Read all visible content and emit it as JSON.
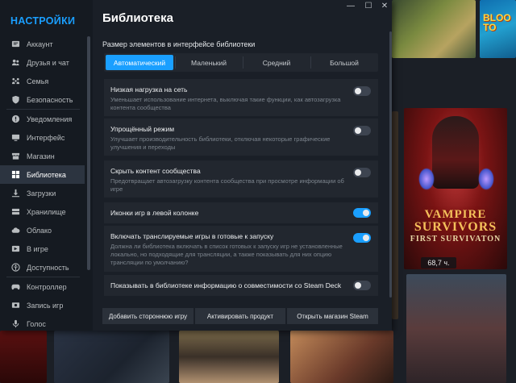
{
  "sidebar": {
    "title": "НАСТРОЙКИ",
    "items": [
      {
        "label": "Аккаунт",
        "icon": "account-icon"
      },
      {
        "label": "Друзья и чат",
        "icon": "friends-icon"
      },
      {
        "label": "Семья",
        "icon": "family-icon"
      },
      {
        "label": "Безопасность",
        "icon": "shield-icon"
      },
      {
        "label": "Уведомления",
        "icon": "notifications-icon"
      },
      {
        "label": "Интерфейс",
        "icon": "monitor-icon"
      },
      {
        "label": "Магазин",
        "icon": "store-icon"
      },
      {
        "label": "Библиотека",
        "icon": "library-grid-icon",
        "active": true
      },
      {
        "label": "Загрузки",
        "icon": "download-icon"
      },
      {
        "label": "Хранилище",
        "icon": "storage-icon"
      },
      {
        "label": "Облако",
        "icon": "cloud-icon"
      },
      {
        "label": "В игре",
        "icon": "in-game-icon"
      },
      {
        "label": "Доступность",
        "icon": "accessibility-icon"
      },
      {
        "label": "Контроллер",
        "icon": "controller-icon"
      },
      {
        "label": "Запись игр",
        "icon": "game-recording-icon"
      },
      {
        "label": "Голос",
        "icon": "microphone-icon"
      }
    ]
  },
  "window": {
    "minimize": "—",
    "maximize": "☐",
    "close": "✕"
  },
  "page": {
    "title": "Библиотека",
    "size_label": "Размер элементов в интерфейсе библиотеки",
    "size_options": [
      "Автоматический",
      "Маленький",
      "Средний",
      "Большой"
    ],
    "size_selected": "Автоматический",
    "options": [
      {
        "title": "Низкая нагрузка на сеть",
        "desc": "Уменьшает использование интернета, выключая такие функции, как автозагрузка контента сообщества",
        "on": false
      },
      {
        "title": "Упрощённый режим",
        "desc": "Улучшает производительность библиотеки, отключая некоторые графические улучшения и переходы",
        "on": false
      },
      {
        "title": "Скрыть контент сообщества",
        "desc": "Предотвращает автозагрузку контента сообщества при просмотре информации об игре",
        "on": false
      },
      {
        "title": "Иконки игр в левой колонке",
        "desc": "",
        "on": true
      },
      {
        "title": "Включать транслируемые игры в готовые к запуску",
        "desc": "Должна ли библиотека включать в список готовых к запуску игр не установленные локально, но подходящие для трансляции, а также показывать для них опцию трансляции по умолчанию?",
        "on": true
      },
      {
        "title": "Показывать в библиотеке информацию о совместимости со Steam Deck",
        "desc": "",
        "on": false
      }
    ],
    "footer_buttons": [
      "Добавить стороннюю игру",
      "Активировать продукт",
      "Открыть магазин Steam"
    ]
  },
  "background": {
    "featured_game": {
      "line1": "VAMPIRE",
      "line2": "SURVIVORS",
      "line3": "FIRST SURVIVATON",
      "hours": "68,7 ч."
    },
    "top_right_logo": "BLOO TO"
  }
}
